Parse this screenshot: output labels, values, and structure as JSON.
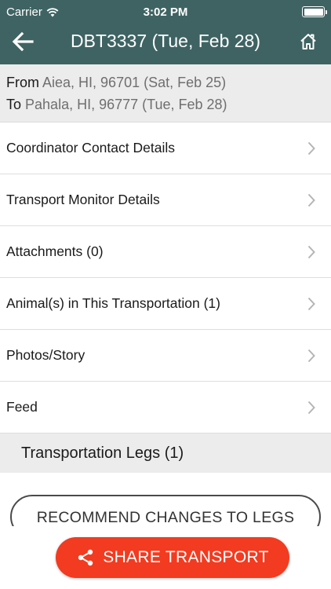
{
  "status_bar": {
    "carrier": "Carrier",
    "time": "3:02 PM",
    "icons": [
      "wifi-icon",
      "battery-icon"
    ]
  },
  "nav": {
    "title": "DBT3337 (Tue, Feb 28)",
    "back_icon": "arrow-left-icon",
    "home_icon": "home-icon"
  },
  "route": {
    "from_label": "From",
    "from_value": "Aiea, HI, 96701 (Sat, Feb 25)",
    "to_label": "To",
    "to_value": "Pahala, HI, 96777 (Tue, Feb 28)"
  },
  "menu": {
    "items": [
      {
        "label": "Coordinator Contact Details"
      },
      {
        "label": "Transport Monitor Details"
      },
      {
        "label": "Attachments (0)"
      },
      {
        "label": "Animal(s) in This Transportation (1)"
      },
      {
        "label": "Photos/Story"
      },
      {
        "label": "Feed"
      }
    ]
  },
  "legs": {
    "section_title": "Transportation Legs (1)",
    "recommend_label": "RECOMMEND CHANGES TO LEGS"
  },
  "share": {
    "label": "SHARE TRANSPORT",
    "icon": "share-icon"
  },
  "colors": {
    "header_bg": "#3f6363",
    "share_button": "#f23b20",
    "section_bg": "#ececec"
  }
}
